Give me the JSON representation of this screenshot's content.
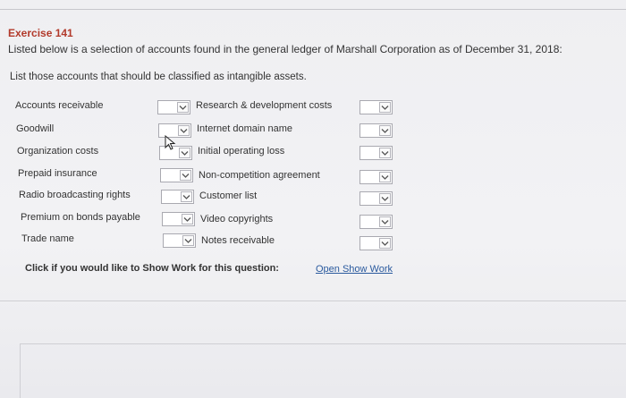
{
  "exercise": {
    "title": "Exercise 141",
    "intro": "Listed below is a selection of accounts found in the general ledger of Marshall Corporation as of December 31, 2018:",
    "question": "List those accounts that should be classified as intangible assets."
  },
  "left_accounts": [
    {
      "label": "Accounts receivable"
    },
    {
      "label": "Goodwill"
    },
    {
      "label": "Organization costs"
    },
    {
      "label": "Prepaid insurance"
    },
    {
      "label": "Radio broadcasting rights"
    },
    {
      "label": "Premium on bonds payable"
    },
    {
      "label": "Trade name"
    }
  ],
  "right_accounts": [
    {
      "label": "Research & development costs"
    },
    {
      "label": "Internet domain name"
    },
    {
      "label": "Initial operating loss"
    },
    {
      "label": "Non-competition agreement"
    },
    {
      "label": "Customer list"
    },
    {
      "label": "Video copyrights"
    },
    {
      "label": "Notes receivable"
    }
  ],
  "footer": {
    "show_work_prompt": "Click if you would like to Show Work for this question:",
    "show_work_link": "Open Show Work"
  },
  "colors": {
    "title": "#b23a2b",
    "link": "#2a5a9e"
  },
  "icons": {
    "dropdown": "chevron-down-icon",
    "cursor": "mouse-pointer-icon"
  }
}
